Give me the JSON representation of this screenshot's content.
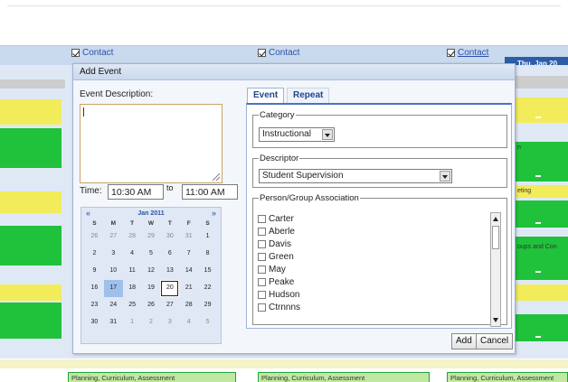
{
  "background": {
    "contacts": [
      {
        "label": "Contact",
        "checked": true
      },
      {
        "label": "Contact",
        "checked": true
      },
      {
        "label": "Contact",
        "checked": true
      }
    ],
    "day_header": "Thu, Jan 20",
    "side_texts": [
      "n",
      "eting",
      "oups and Con"
    ],
    "bottom_bars": [
      "Planning, Curriculum, Assessment",
      "Planning, Curriculum, Assessment",
      "Planning, Curriculum, Assessment"
    ],
    "colors": {
      "band": "#c9d9ee",
      "green": "#1fc23a",
      "yellow": "#f2ec5a",
      "header": "#2e5da8"
    }
  },
  "dialog": {
    "title": "Add Event",
    "description_label": "Event Description:",
    "description_value": "",
    "time_label": "Time:",
    "start_time": "10:30 AM",
    "to_label": "to",
    "end_time": "11:00 AM",
    "calendar": {
      "prev": "«",
      "next": "»",
      "month": "Jan 2011",
      "weekdays": [
        "S",
        "M",
        "T",
        "W",
        "T",
        "F",
        "S"
      ],
      "weeks": [
        [
          "26",
          "27",
          "28",
          "29",
          "30",
          "31",
          "1"
        ],
        [
          "2",
          "3",
          "4",
          "5",
          "6",
          "7",
          "8"
        ],
        [
          "9",
          "10",
          "11",
          "12",
          "13",
          "14",
          "15"
        ],
        [
          "16",
          "17",
          "18",
          "19",
          "20",
          "21",
          "22"
        ],
        [
          "23",
          "24",
          "25",
          "26",
          "27",
          "28",
          "29"
        ],
        [
          "30",
          "31",
          "1",
          "2",
          "3",
          "4",
          "5"
        ]
      ],
      "today": "17",
      "selected": "20"
    },
    "tabs": [
      {
        "label": "Event",
        "active": true
      },
      {
        "label": "Repeat",
        "active": false
      }
    ],
    "category_legend": "Category",
    "category_value": "Instructional",
    "descriptor_legend": "Descriptor",
    "descriptor_value": "Student Supervision",
    "person_legend": "Person/Group Association",
    "persons": [
      "Carter",
      "Aberle",
      "Davis",
      "Green",
      "May",
      "Peake",
      "Hudson",
      "Ctrnnns"
    ],
    "add_button": "Add",
    "cancel_button": "Cancel"
  }
}
